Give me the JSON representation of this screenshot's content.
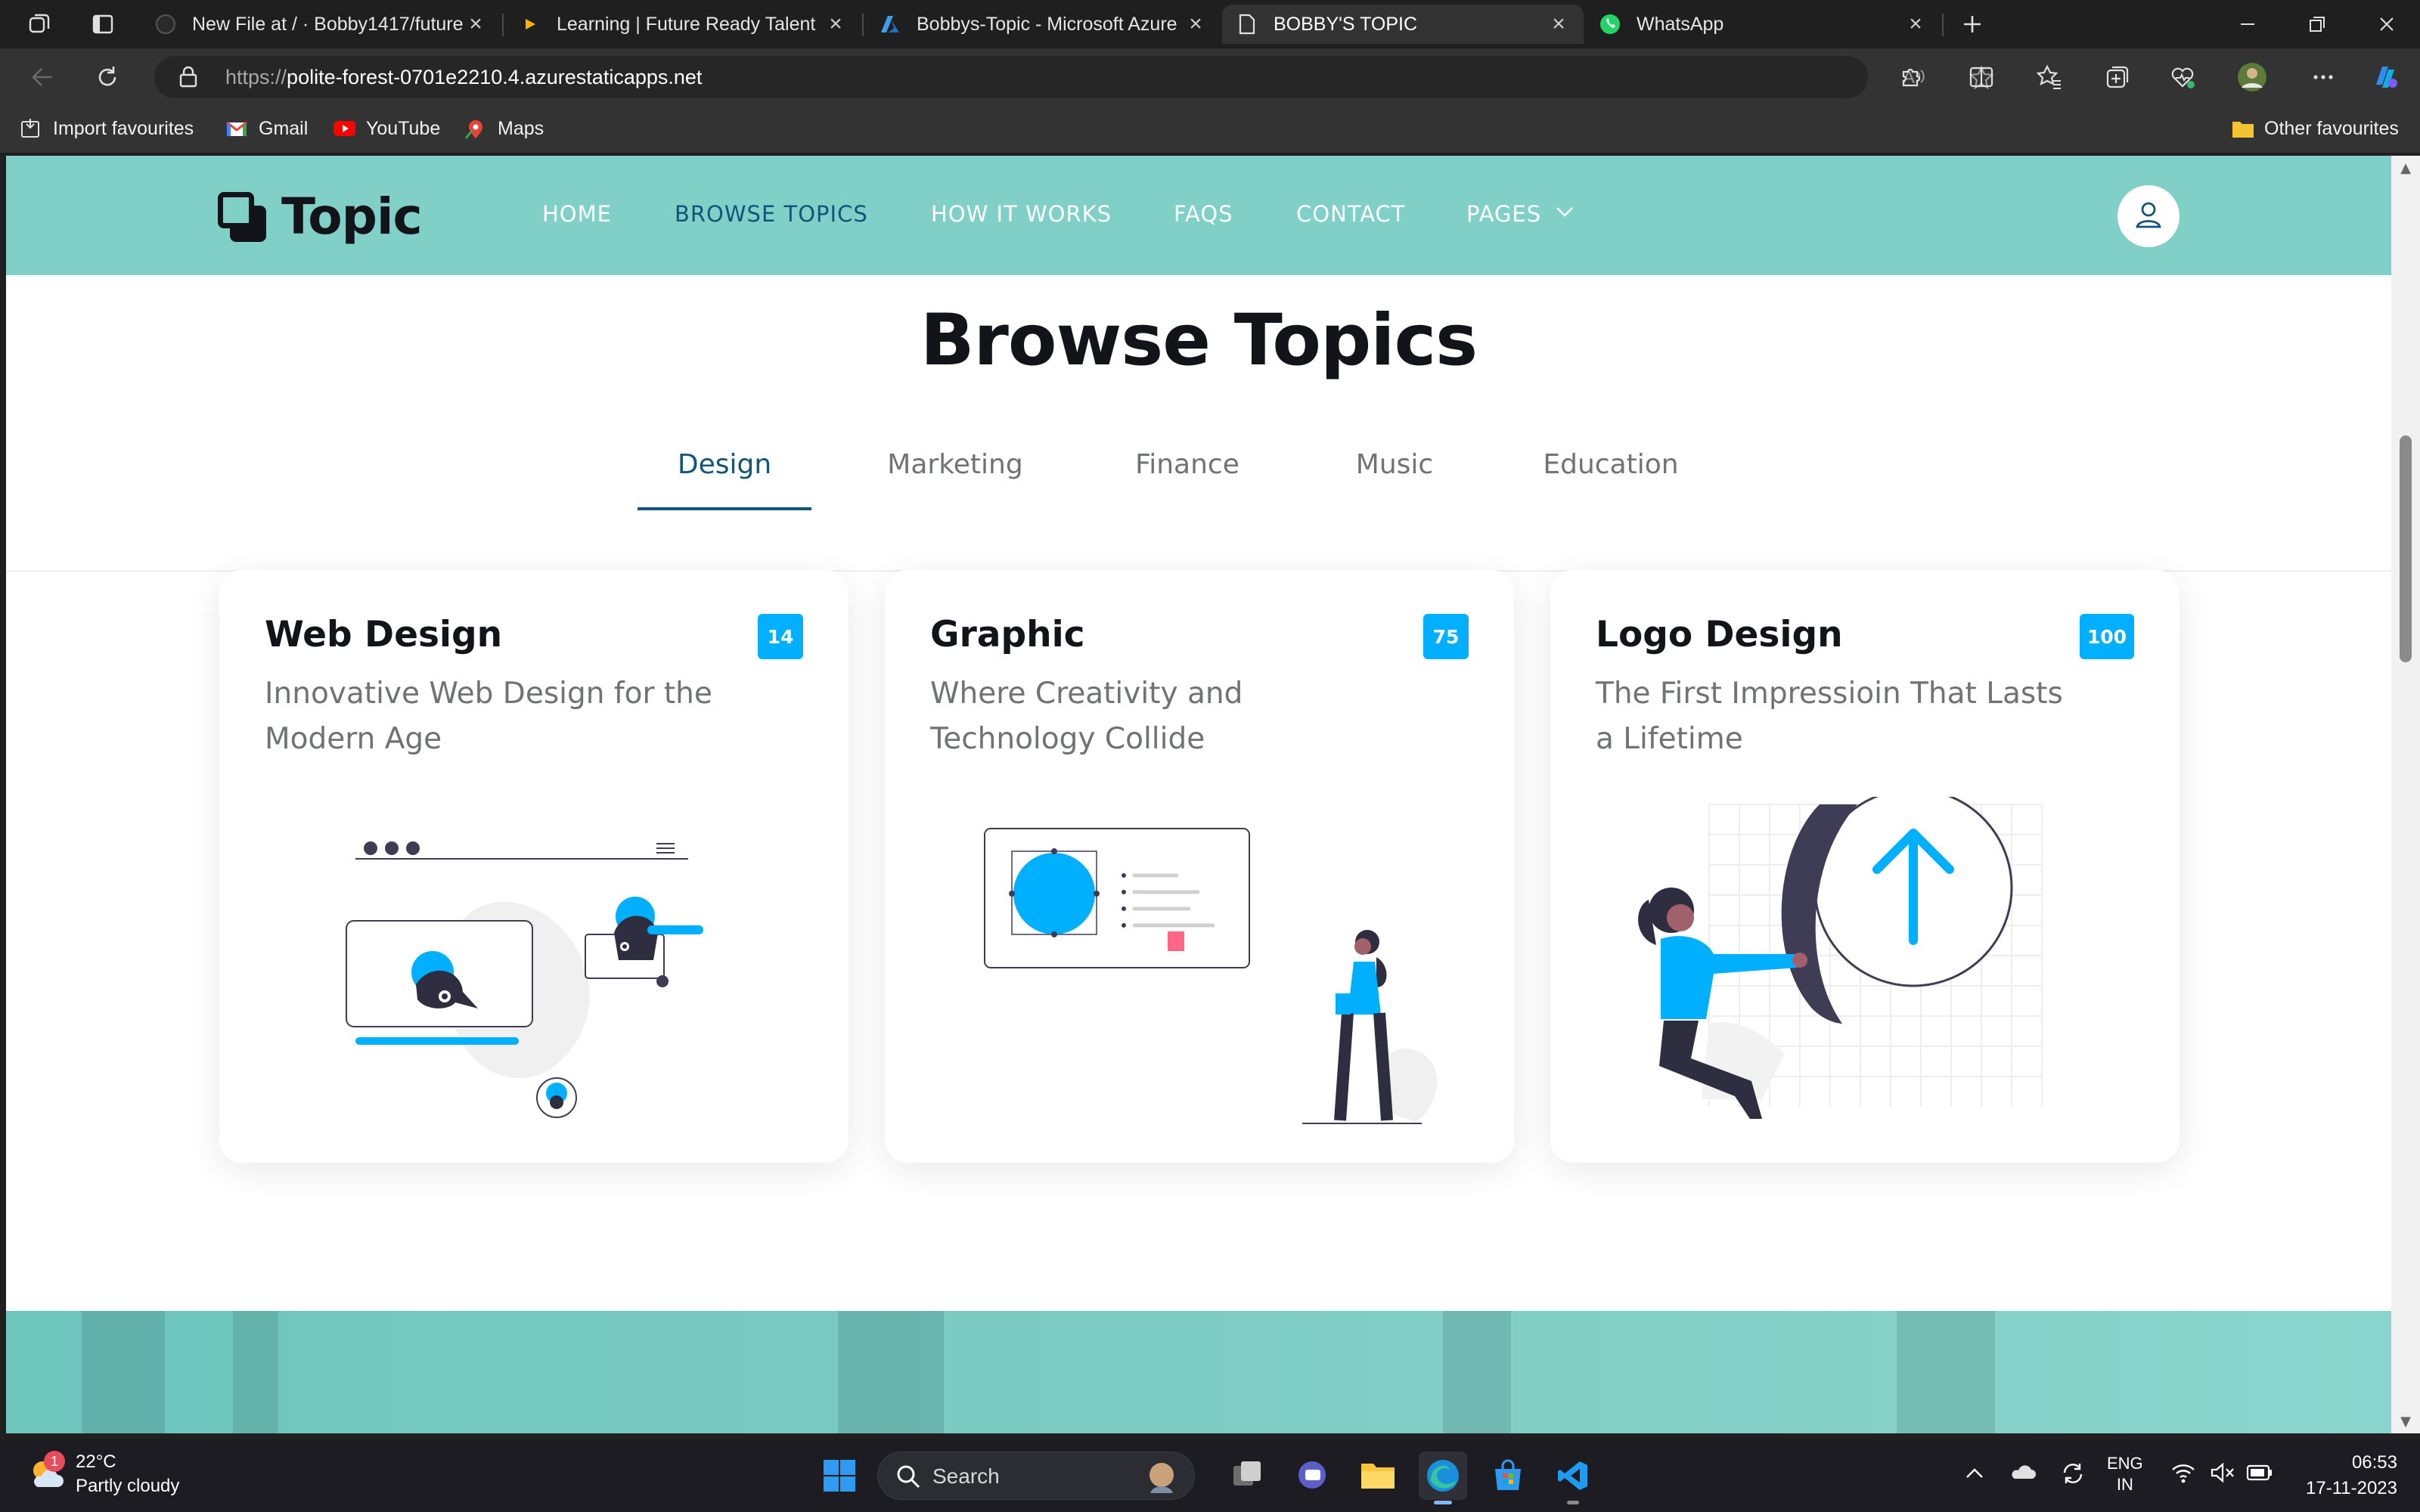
{
  "browser": {
    "tabs": [
      {
        "title": "New File at / · Bobby1417/future",
        "favicon": "github-icon"
      },
      {
        "title": "Learning | Future Ready Talent",
        "favicon": "play-icon"
      },
      {
        "title": "Bobbys-Topic - Microsoft Azure",
        "favicon": "azure-icon"
      },
      {
        "title": "BOBBY'S TOPIC",
        "favicon": "page-icon",
        "active": true
      },
      {
        "title": "WhatsApp",
        "favicon": "whatsapp-icon"
      }
    ],
    "url_scheme": "https://",
    "url_host": "polite-forest-0701e2210.4.azurestaticapps.net",
    "favourites": [
      {
        "label": "Import favourites",
        "icon": "import-icon"
      },
      {
        "label": "Gmail",
        "icon": "gmail-icon"
      },
      {
        "label": "YouTube",
        "icon": "youtube-icon"
      },
      {
        "label": "Maps",
        "icon": "maps-icon"
      }
    ],
    "other_favourites": "Other favourites"
  },
  "site": {
    "brand": "Topic",
    "nav": [
      "HOME",
      "BROWSE TOPICS",
      "HOW IT WORKS",
      "FAQS",
      "CONTACT",
      "PAGES"
    ],
    "active_nav": "BROWSE TOPICS",
    "accent_color": "#80d0c7",
    "heading_color": "#13547a",
    "badge_color": "#00b0ff"
  },
  "browse": {
    "title": "Browse Topics",
    "tabs": [
      "Design",
      "Marketing",
      "Finance",
      "Music",
      "Education"
    ],
    "active_tab": "Design",
    "cards": [
      {
        "title": "Web Design",
        "description": "Innovative Web Design for the Modern Age",
        "count": "14"
      },
      {
        "title": "Graphic",
        "description": "Where Creativity and Technology Collide",
        "count": "75"
      },
      {
        "title": "Logo Design",
        "description": "The First Impressioin That Lasts a Lifetime",
        "count": "100"
      }
    ]
  },
  "taskbar": {
    "weather_temp": "22°C",
    "weather_desc": "Partly cloudy",
    "weather_badge": "1",
    "search_label": "Search",
    "lang_top": "ENG",
    "lang_bottom": "IN",
    "time": "06:53",
    "date": "17-11-2023"
  }
}
